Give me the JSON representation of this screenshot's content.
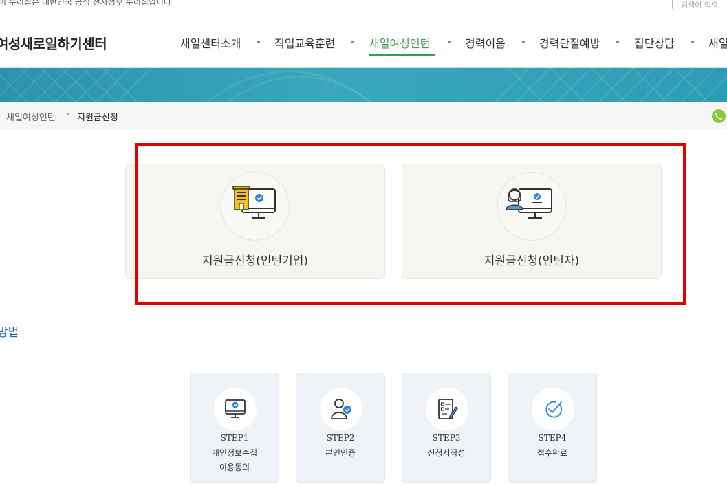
{
  "banner": {
    "notice": "이 누리집은 대한민국 공식 전자정부 누리집입니다",
    "search_placeholder": "검색어 입력"
  },
  "header": {
    "logo": "여성새로일하기센터",
    "nav": [
      {
        "label": "새일센터소개",
        "active": false
      },
      {
        "label": "직업교육훈련",
        "active": false
      },
      {
        "label": "새일여성인턴",
        "active": true
      },
      {
        "label": "경력이음",
        "active": false
      },
      {
        "label": "경력단절예방",
        "active": false
      },
      {
        "label": "집단상담",
        "active": false
      },
      {
        "label": "새일",
        "active": false
      }
    ],
    "active_color": "#3c9a58"
  },
  "breadcrumb": {
    "parent": "새일여성인턴",
    "separator": "›",
    "current": "지원금신청"
  },
  "cards": [
    {
      "label": "지원금신청(인턴기업)",
      "icon": "company-monitor-icon"
    },
    {
      "label": "지원금신청(인턴자)",
      "icon": "intern-monitor-icon"
    }
  ],
  "section": {
    "title_tail": "방법"
  },
  "steps": [
    {
      "name": "STEP1",
      "lines": [
        "개인정보수집",
        "이용동의"
      ],
      "icon": "monitor-check-icon"
    },
    {
      "name": "STEP2",
      "lines": [
        "본인인증"
      ],
      "icon": "user-check-icon"
    },
    {
      "name": "STEP3",
      "lines": [
        "신청서작성"
      ],
      "icon": "form-pen-icon"
    },
    {
      "name": "STEP4",
      "lines": [
        "접수완료"
      ],
      "icon": "check-circle-icon"
    }
  ],
  "colors": {
    "hero": "#2e9cb4",
    "highlight": "#e30000",
    "accent_blue": "#1a5fb4"
  }
}
